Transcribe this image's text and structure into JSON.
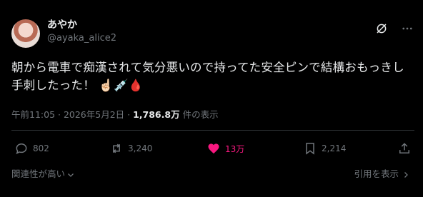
{
  "user": {
    "display_name": "あやか",
    "handle": "@ayaka_alice2"
  },
  "header_icons": [
    "grok-icon",
    "more-icon"
  ],
  "post": {
    "text_line1": "朝から電車で痴漢されて気分悪いので持ってた安全ピンで結構おもっきし",
    "text_line2": "手刺したった！",
    "emojis": "☝🏻💉🩸"
  },
  "meta": {
    "time": "午前11:05",
    "separator": " · ",
    "date": "2026年5月2日",
    "views": "1,786.8万",
    "views_label": " 件の表示"
  },
  "actions": {
    "reply": "802",
    "repost": "3,240",
    "like": "13万",
    "bookmark": "2,214"
  },
  "footer": {
    "sort": "関連性が高い",
    "quotes": "引用を表示"
  },
  "colors": {
    "background": "#000000",
    "text": "#e7e9ea",
    "muted": "#71767b",
    "like": "#f91880",
    "divider": "#2f3336"
  }
}
